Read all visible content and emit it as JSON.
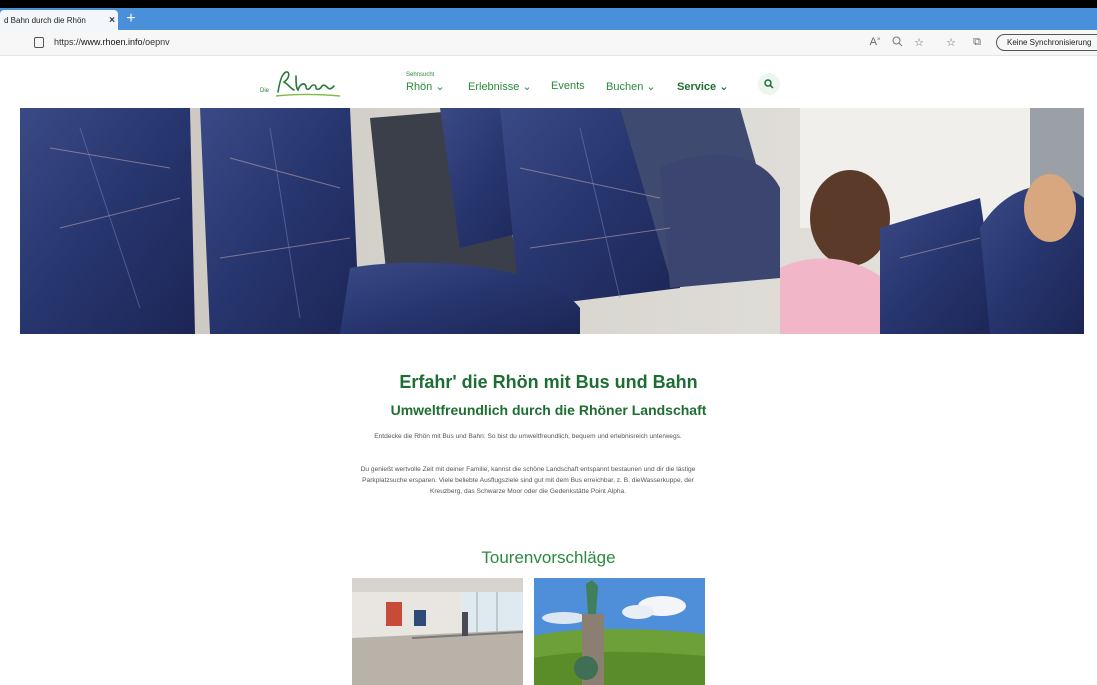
{
  "browser": {
    "tab_title": "d Bahn durch die Rhön",
    "tab_close": "×",
    "new_tab": "+",
    "url_prefix": "https://",
    "url_domain": "www.rhoen.info",
    "url_path": "/oepnv",
    "toolbar_icons": [
      "read-aloud-icon",
      "zoom-icon",
      "favorite-add-icon",
      "favorites-icon",
      "collections-icon"
    ],
    "sync_label": "Keine Synchronisierung"
  },
  "site": {
    "logo_prefix": "Die",
    "logo_text": "Rhön",
    "brand_color": "#1e6e34",
    "nav": {
      "sehnsucht_sub": "Sehnsucht",
      "sehnsucht": "Rhön ⌄",
      "erlebnisse": "Erlebnisse ⌄",
      "events": "Events",
      "buchen": "Buchen ⌄",
      "service": "Service ⌄"
    }
  },
  "main": {
    "heading": "Erfahr' die Rhön mit Bus und Bahn",
    "subheading": "Umweltfreundlich durch die Rhöner Landschaft",
    "intro": "Entdecke die Rhön mit Bus und Bahn: So bist du umweltfreundlich, bequem und erlebnisreich unterwegs.",
    "body": "Du genießt wertvolle Zeit mit deiner Familie, kannst die schöne Landschaft entspannt bestaunen und dir die lästige Parkplatzsuche ersparen. Viele beliebte Ausflugsziele sind gut mit dem Bus erreichbar, z. B. dieWasserkuppe, der Kreuzberg, das Schwarze Moor oder die Gedenkstätte Point Alpha.",
    "tours_heading": "Tourenvorschläge"
  }
}
